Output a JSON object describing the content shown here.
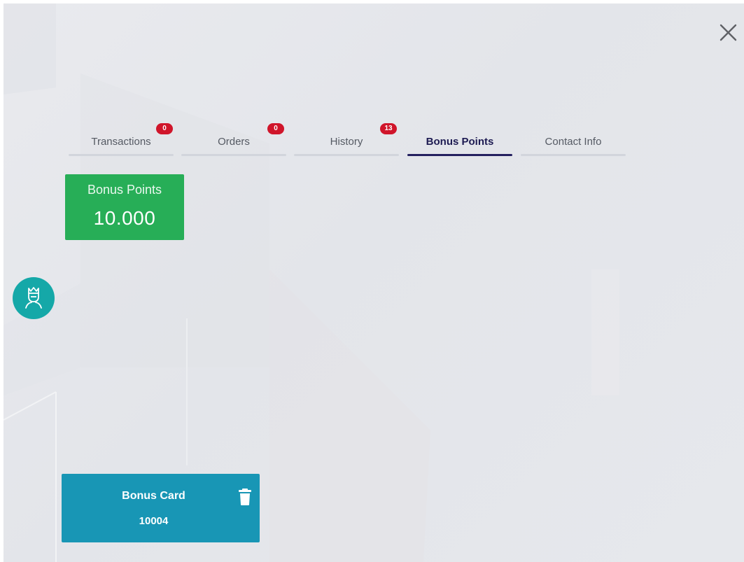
{
  "tabs": [
    {
      "label": "Transactions",
      "badge": "0",
      "active": false
    },
    {
      "label": "Orders",
      "badge": "0",
      "active": false
    },
    {
      "label": "History",
      "badge": "13",
      "active": false
    },
    {
      "label": "Bonus Points",
      "badge": null,
      "active": true
    },
    {
      "label": "Contact Info",
      "badge": null,
      "active": false
    }
  ],
  "points_card": {
    "label": "Bonus Points",
    "value": "10.000",
    "color": "#27ae57"
  },
  "bonus_card": {
    "title": "Bonus Card",
    "number": "10004",
    "color": "#1896b5"
  },
  "icons": {
    "close": "close-icon",
    "avatar": "customer-crown-icon",
    "delete": "trash-icon"
  },
  "colors": {
    "badge": "#d0152a",
    "active_tab": "#24205f",
    "avatar": "#15a8a8"
  }
}
